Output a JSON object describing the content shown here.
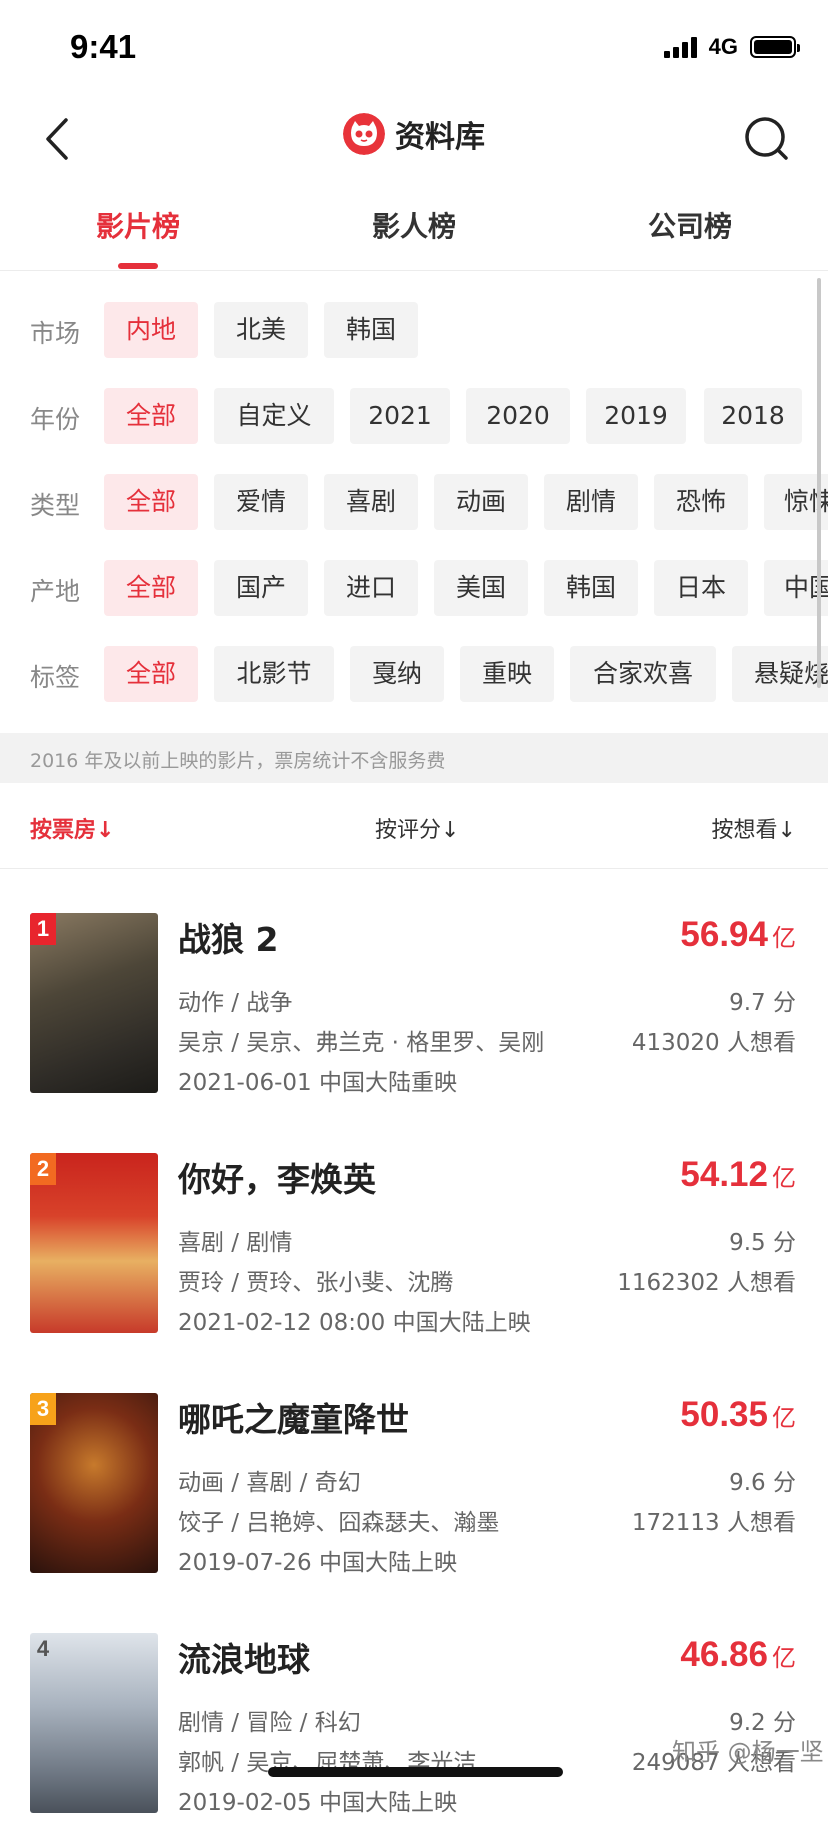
{
  "status_bar": {
    "time": "9:41",
    "network": "4G"
  },
  "header": {
    "title": "资料库"
  },
  "tabs": [
    {
      "label": "影片榜",
      "active": true
    },
    {
      "label": "影人榜",
      "active": false
    },
    {
      "label": "公司榜",
      "active": false
    }
  ],
  "filters": {
    "market": {
      "label": "市场",
      "options": [
        "内地",
        "北美",
        "韩国"
      ],
      "selected": "内地"
    },
    "year": {
      "label": "年份",
      "options": [
        "全部",
        "自定义",
        "2021",
        "2020",
        "2019",
        "2018"
      ],
      "selected": "全部"
    },
    "genre": {
      "label": "类型",
      "options": [
        "全部",
        "爱情",
        "喜剧",
        "动画",
        "剧情",
        "恐怖",
        "惊悚"
      ],
      "selected": "全部"
    },
    "origin": {
      "label": "产地",
      "options": [
        "全部",
        "国产",
        "进口",
        "美国",
        "韩国",
        "日本",
        "中国"
      ],
      "selected": "全部"
    },
    "tag": {
      "label": "标签",
      "options": [
        "全部",
        "北影节",
        "戛纳",
        "重映",
        "合家欢喜",
        "悬疑烧脑"
      ],
      "selected": "全部"
    }
  },
  "notice": "2016 年及以前上映的影片，票房统计不含服务费",
  "sort": {
    "box_office": "按票房",
    "rating": "按评分",
    "want_see": "按想看",
    "active": "box_office"
  },
  "movies": [
    {
      "rank": "1",
      "title": "战狼 2",
      "genres": "动作 / 战争",
      "people": "吴京 / 吴京、弗兰克 · 格里罗、吴刚",
      "release": "2021-06-01 中国大陆重映",
      "box_office": "56.94",
      "box_unit": "亿",
      "score": "9.7 分",
      "want": "413020 人想看"
    },
    {
      "rank": "2",
      "title": "你好，李焕英",
      "genres": "喜剧 / 剧情",
      "people": "贾玲 / 贾玲、张小斐、沈腾",
      "release": "2021-02-12 08:00 中国大陆上映",
      "box_office": "54.12",
      "box_unit": "亿",
      "score": "9.5 分",
      "want": "1162302 人想看"
    },
    {
      "rank": "3",
      "title": "哪吒之魔童降世",
      "genres": "动画 / 喜剧 / 奇幻",
      "people": "饺子 / 吕艳婷、囧森瑟夫、瀚墨",
      "release": "2019-07-26 中国大陆上映",
      "box_office": "50.35",
      "box_unit": "亿",
      "score": "9.6 分",
      "want": "172113 人想看"
    },
    {
      "rank": "4",
      "title": "流浪地球",
      "genres": "剧情 / 冒险 / 科幻",
      "people": "郭帆 / 吴京、屈楚萧、李光洁",
      "release": "2019-02-05 中国大陆上映",
      "box_office": "46.86",
      "box_unit": "亿",
      "score": "9.2 分",
      "want": "249087 人想看"
    }
  ],
  "watermark": "知乎 @杨一坚",
  "colors": {
    "accent": "#e5303b",
    "chip_bg": "#f3f3f3",
    "chip_selected_bg": "#fde8ea",
    "rank1": "#e8252d",
    "rank2": "#f26a21",
    "rank3": "#f7a21a",
    "rank4": "#cfcfcf"
  }
}
